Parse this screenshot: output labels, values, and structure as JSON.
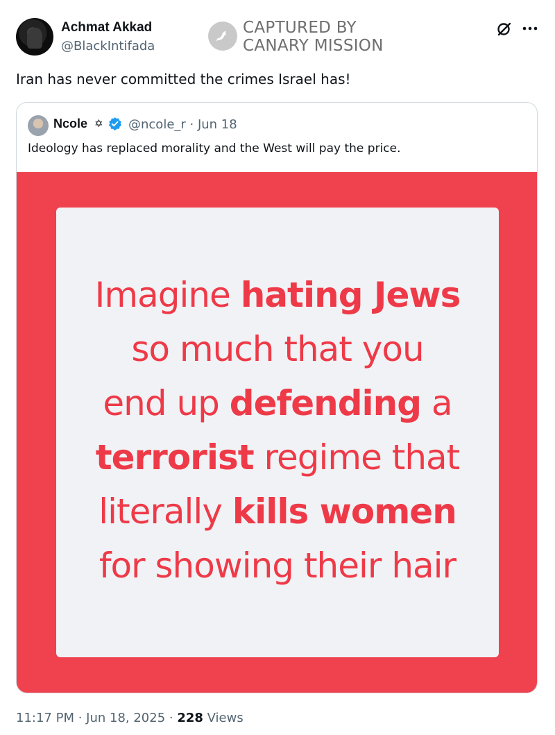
{
  "author": {
    "name": "Achmat Akkad",
    "handle": "@BlackIntifada"
  },
  "watermark": {
    "line1": "CAPTURED BY",
    "line2": "CANARY MISSION"
  },
  "tweet": {
    "text": "Iran has never committed the crimes Israel has!"
  },
  "quoted": {
    "name": "Ncole",
    "name_symbol": "✡",
    "verified": true,
    "handle_date": "@ncole_r · Jun 18",
    "text": "Ideology has replaced morality and the West will pay the price.",
    "image_lines": [
      [
        "Imagine ",
        "hating Jews",
        ""
      ],
      [
        "so much that you",
        "",
        ""
      ],
      [
        "end up ",
        "defending",
        " a"
      ],
      [
        "",
        "terrorist",
        " regime that"
      ],
      [
        "literally ",
        "kills women",
        ""
      ],
      [
        "for showing their hair",
        "",
        ""
      ]
    ],
    "image_colors": {
      "background": "#f0414e",
      "card": "#f1f2f5",
      "text": "#ee3a48"
    }
  },
  "meta": {
    "timestamp": "11:17 PM · Jun 18, 2025 · ",
    "views_count": "228",
    "views_label": " Views"
  },
  "icons": {
    "grok": "grok-icon",
    "more": "more-icon",
    "verified": "verified-badge-icon",
    "watermark": "bird-icon"
  }
}
